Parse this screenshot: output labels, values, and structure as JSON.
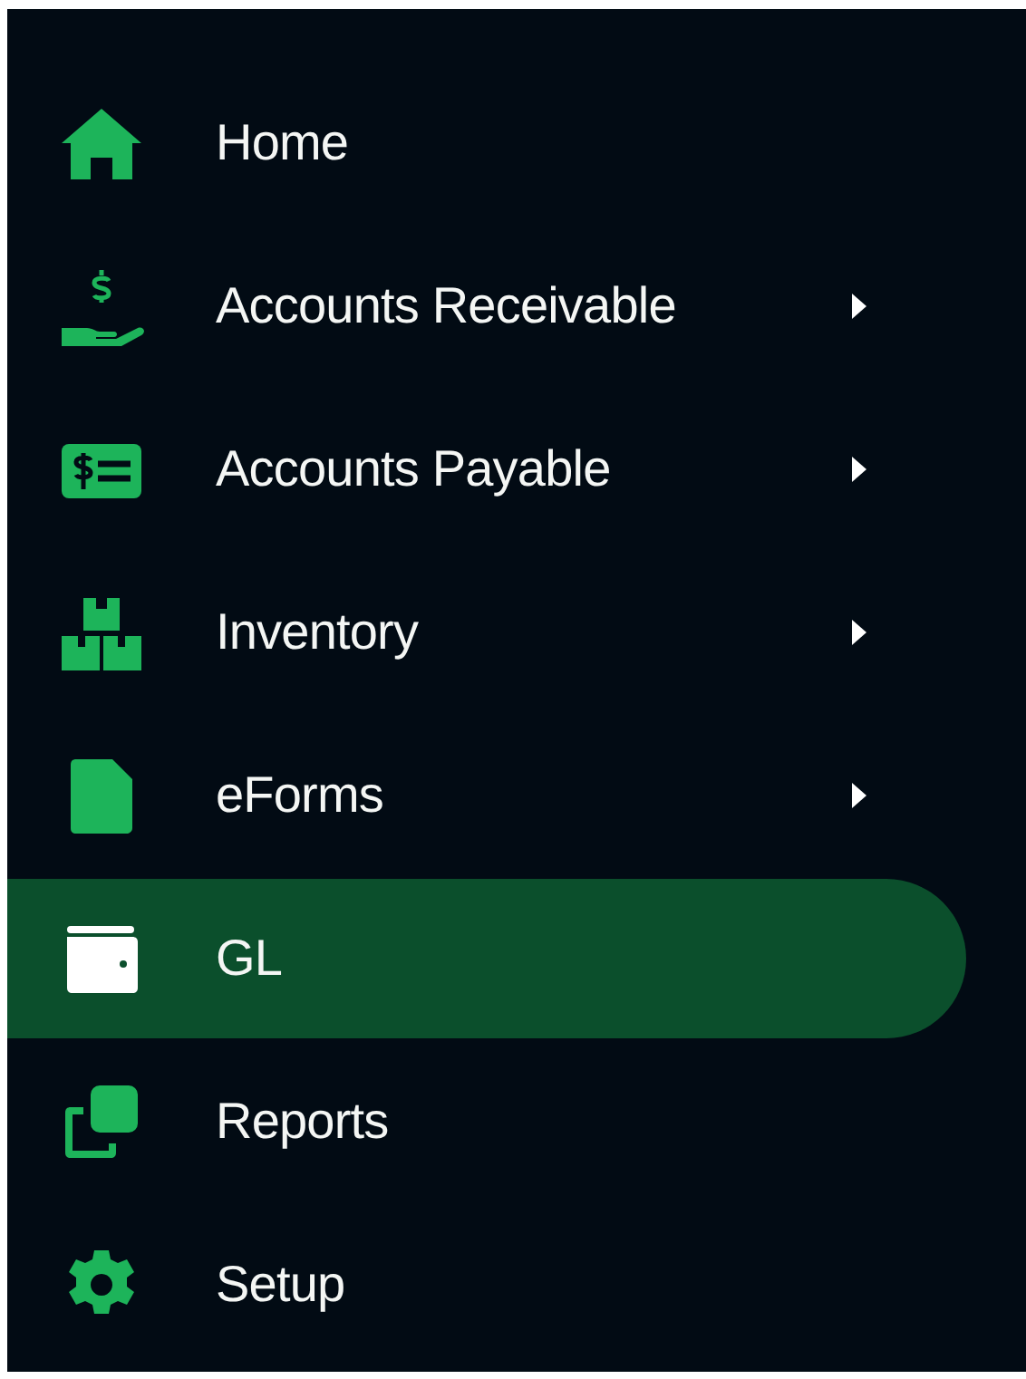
{
  "menu": {
    "items": [
      {
        "label": "Home",
        "expandable": false,
        "selected": false
      },
      {
        "label": "Accounts Receivable",
        "expandable": true,
        "selected": false
      },
      {
        "label": "Accounts Payable",
        "expandable": true,
        "selected": false
      },
      {
        "label": "Inventory",
        "expandable": true,
        "selected": false
      },
      {
        "label": "eForms",
        "expandable": true,
        "selected": false
      },
      {
        "label": "GL",
        "expandable": false,
        "selected": true
      },
      {
        "label": "Reports",
        "expandable": false,
        "selected": false
      },
      {
        "label": "Setup",
        "expandable": false,
        "selected": false
      }
    ]
  }
}
